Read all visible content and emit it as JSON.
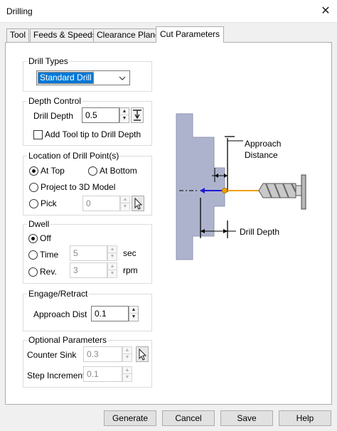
{
  "window": {
    "title": "Drilling",
    "close_label": "✕"
  },
  "tabs": [
    {
      "label": "Tool"
    },
    {
      "label": "Feeds & Speeds"
    },
    {
      "label": "Clearance Plane"
    },
    {
      "label": "Cut Parameters",
      "active": true
    }
  ],
  "drill_types": {
    "label": "Drill Types",
    "selected": "Standard Drill"
  },
  "depth_control": {
    "label": "Depth Control",
    "drill_depth_label": "Drill Depth",
    "drill_depth_value": "0.5",
    "add_tool_tip_label": "Add Tool tip to Drill Depth",
    "add_tool_tip_checked": false
  },
  "location": {
    "label": "Location of Drill Point(s)",
    "at_top": "At Top",
    "at_bottom": "At Bottom",
    "project": "Project to 3D Model",
    "pick": "Pick",
    "pick_value": "0",
    "selected": "At Top"
  },
  "dwell": {
    "label": "Dwell",
    "off": "Off",
    "time": "Time",
    "time_value": "5",
    "time_unit": "sec",
    "rev": "Rev.",
    "rev_value": "3",
    "rev_unit": "rpm",
    "selected": "Off"
  },
  "engage": {
    "label": "Engage/Retract",
    "approach_label": "Approach Dist",
    "approach_value": "0.1"
  },
  "optional": {
    "label": "Optional Parameters",
    "counter_sink_label": "Counter Sink",
    "counter_sink_value": "0.3",
    "step_increment_label": "Step Increment",
    "step_increment_value": "0.1"
  },
  "diagram": {
    "approach_distance_line1": "Approach",
    "approach_distance_line2": "Distance",
    "drill_depth": "Drill Depth"
  },
  "buttons": {
    "generate": "Generate",
    "cancel": "Cancel",
    "save": "Save",
    "help": "Help"
  },
  "colors": {
    "accent": "#0078d7",
    "part": "#aeb3cd",
    "blue_path": "#1a1ad6",
    "orange_path": "#f0a000"
  }
}
